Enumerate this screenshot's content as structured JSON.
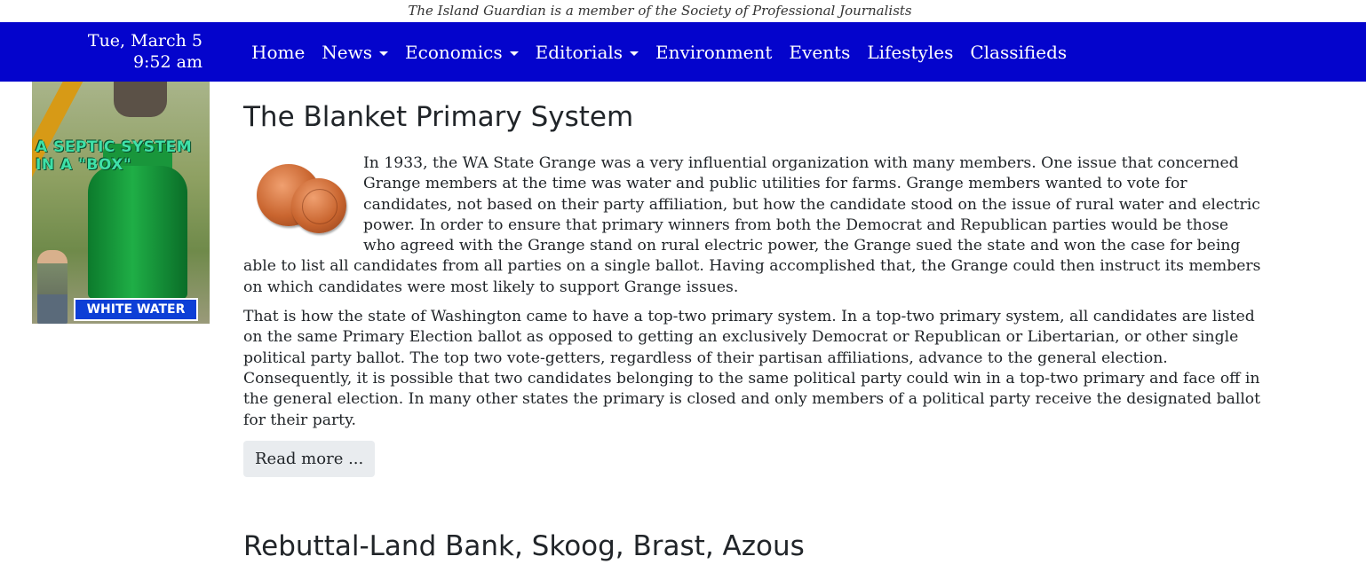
{
  "header": {
    "membership_text": "The Island Guardian is a member of the Society of Professional Journalists",
    "date": "Tue, March 5",
    "time": "9:52 am",
    "bg_color": "#0404cc"
  },
  "nav": {
    "items": [
      {
        "label": "Home",
        "dropdown": false
      },
      {
        "label": "News",
        "dropdown": true
      },
      {
        "label": "Economics",
        "dropdown": true
      },
      {
        "label": "Editorials",
        "dropdown": true
      },
      {
        "label": "Environment",
        "dropdown": false
      },
      {
        "label": "Events",
        "dropdown": false
      },
      {
        "label": "Lifestyles",
        "dropdown": false
      },
      {
        "label": "Classifieds",
        "dropdown": false
      }
    ]
  },
  "sidebar_ad": {
    "headline": "A SEPTIC SYSTEM IN A \"BOX\"",
    "label": "WHITE WATER"
  },
  "article": {
    "title": "The Blanket Primary System",
    "paragraphs": [
      "In 1933, the WA State Grange was a very influential organization with many members. One issue that concerned Grange members at the time was water and public utilities for farms. Grange members wanted to vote for candidates, not based on their party affiliation, but how the candidate stood on the issue of rural water and electric power. In order to ensure that primary winners from both the Democrat and Republican parties would be those who agreed with the Grange stand on rural electric power, the Grange sued the state and won the case for being able to list all candidates from all parties on a single ballot. Having accomplished that, the Grange could then instruct its members on which candidates were most likely to support Grange issues.",
      "That is how the state of Washington came to have a top-two primary system. In a top-two primary system, all candidates are listed on the same Primary Election ballot as opposed to getting an exclusively Democrat or Republican or Libertarian, or other single political party ballot. The top two vote-getters, regardless of their partisan affiliations, advance to the general election. Consequently, it is possible that two candidates belonging to the same political party could win in a top-two primary and face off in the general election. In many other states the primary is closed and only members of a political party receive the designated ballot for their party."
    ],
    "read_more_label": "Read more ..."
  },
  "next_article": {
    "title": "Rebuttal-Land Bank, Skoog, Brast, Azous"
  }
}
